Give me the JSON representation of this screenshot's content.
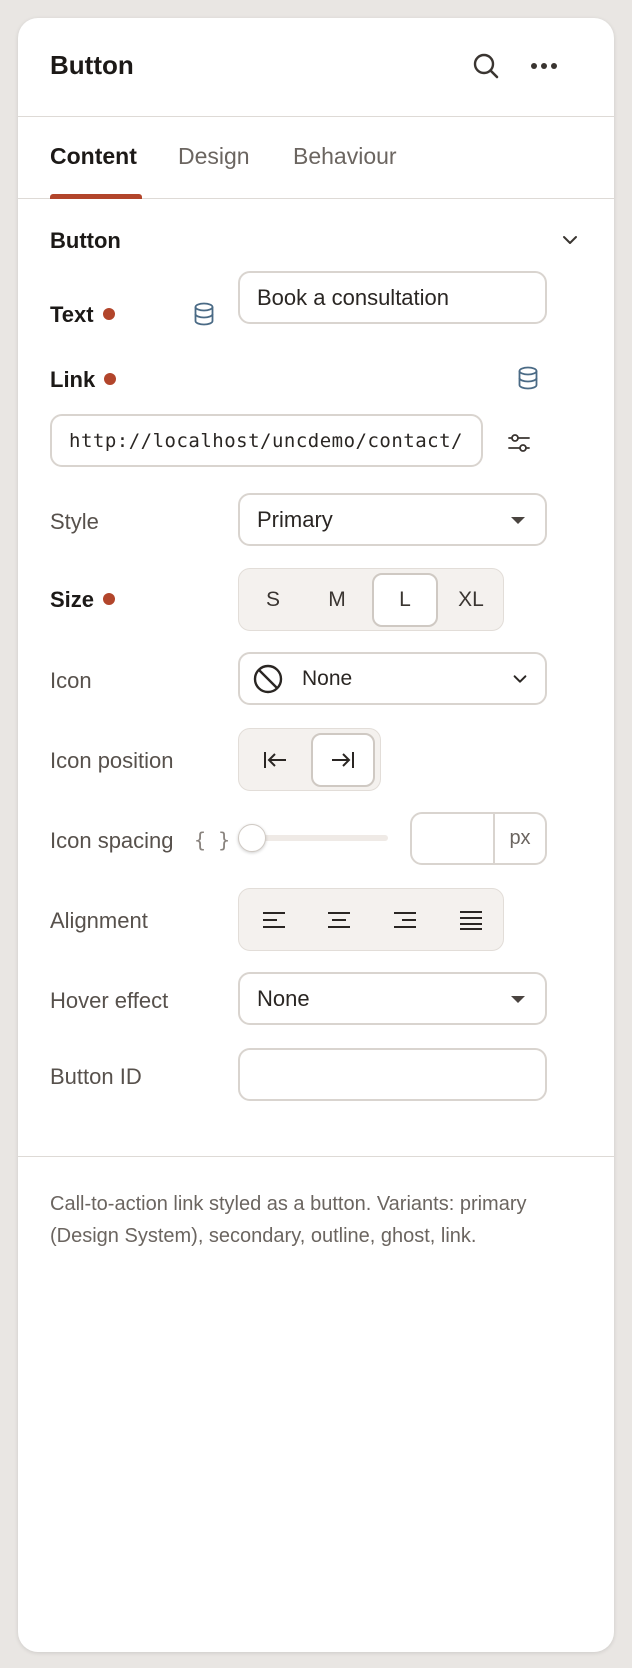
{
  "header": {
    "title": "Button"
  },
  "tabs": [
    {
      "label": "Content"
    },
    {
      "label": "Design"
    },
    {
      "label": "Behaviour"
    }
  ],
  "section": {
    "title": "Button"
  },
  "fields": {
    "text": {
      "label": "Text",
      "value": "Book a consultation"
    },
    "link": {
      "label": "Link",
      "value": "http://localhost/uncdemo/contact/"
    },
    "style": {
      "label": "Style",
      "value": "Primary"
    },
    "size": {
      "label": "Size",
      "options": [
        "S",
        "M",
        "L",
        "XL"
      ],
      "selected": "L"
    },
    "icon": {
      "label": "Icon",
      "value": "None"
    },
    "icon_position": {
      "label": "Icon position",
      "options": [
        "arrow-to-left-icon",
        "arrow-to-right-icon"
      ],
      "selected": "arrow-to-right-icon"
    },
    "icon_spacing": {
      "label": "Icon spacing",
      "dynamic_marker": "{ }",
      "value": "",
      "unit": "px",
      "slider_level": 0
    },
    "alignment": {
      "label": "Alignment",
      "options": [
        "align-left-icon",
        "align-center-icon",
        "align-right-icon",
        "align-justify-icon"
      ]
    },
    "hover_effect": {
      "label": "Hover effect",
      "value": "None"
    },
    "button_id": {
      "label": "Button ID",
      "value": ""
    }
  },
  "description": "Call-to-action link styled as a button. Variants: primary (Design System), secondary, outline, ghost, link.",
  "colors": {
    "accent": "#b2452b",
    "border": "#d9d4cf",
    "muted_text": "#6b6560",
    "dynamic_icon": "#4a6a85"
  }
}
